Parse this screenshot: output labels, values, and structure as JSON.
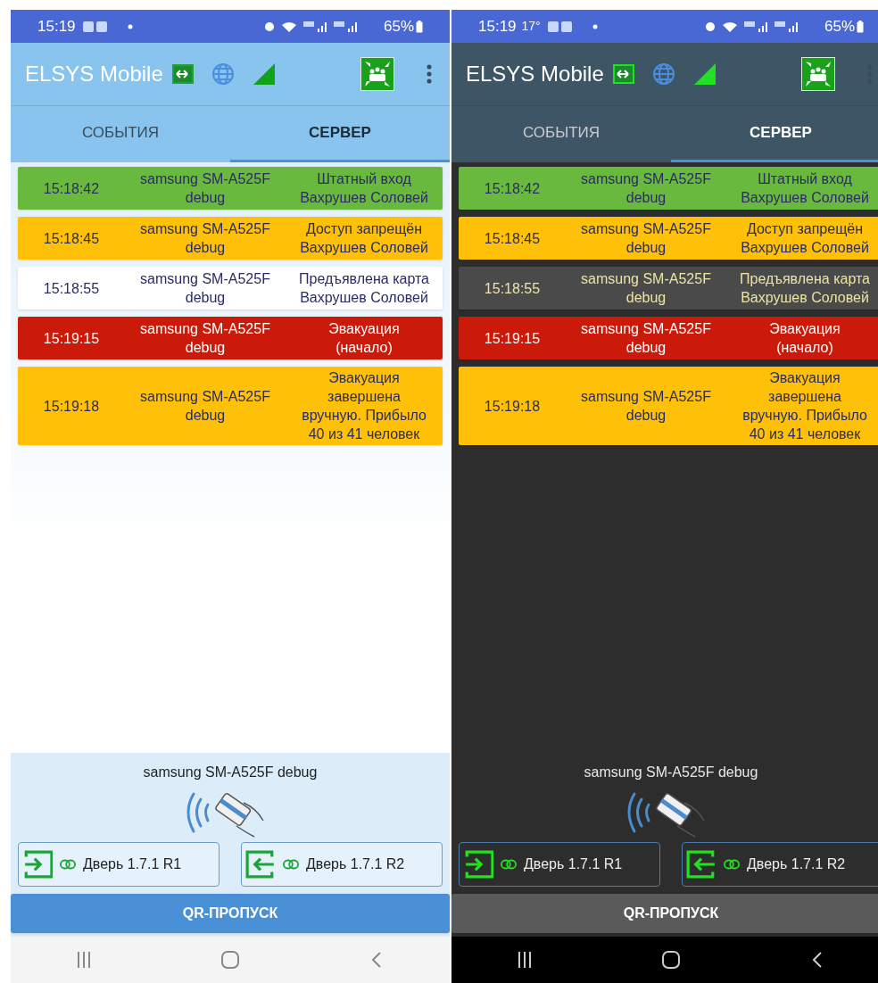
{
  "screens": [
    {
      "dark_mode": false,
      "status_bar": {
        "time": "15:19",
        "battery": "65%"
      },
      "app_bar": {
        "title": "ELSYS Mobile"
      },
      "tabs": [
        {
          "label": "СОБЫТИЯ",
          "selected": false
        },
        {
          "label": "СЕРВЕР",
          "selected": true
        }
      ],
      "events": [
        {
          "kind": "pass",
          "time": "15:18:42",
          "device": "samsung SM-A525F\ndebug",
          "event": "Штатный вход\nВахрушев Соловей",
          "color": "#6ab93f"
        },
        {
          "kind": "denied",
          "time": "15:18:45",
          "device": "samsung SM-A525F\ndebug",
          "event": "Доступ запрещён\nВахрушев Соловей",
          "color": "#ffc107"
        },
        {
          "kind": "card",
          "time": "15:18:55",
          "device": "samsung SM-A525F\ndebug",
          "event": "Предъявлена карта\nВахрушев Соловей",
          "color": "#ffffff"
        },
        {
          "kind": "alarm",
          "time": "15:19:15",
          "device": "samsung SM-A525F\ndebug",
          "event": "Эвакуация\n(начало)",
          "color": "#cc1a0a"
        },
        {
          "kind": "evacuation_end",
          "time": "15:19:18",
          "device": "samsung SM-A525F\ndebug",
          "event": "Эвакуация\nзавершена\nвручную. Прибыло\n40 из 41 человек",
          "color": "#ffc107"
        }
      ],
      "reader": {
        "device": "samsung SM-A525F debug"
      },
      "doors": [
        {
          "kind": "entry",
          "label": "Дверь 1.7.1 R1"
        },
        {
          "kind": "exit",
          "label": "Дверь 1.7.1 R2"
        }
      ],
      "qr_button": "QR-ПРОПУСК"
    },
    {
      "dark_mode": true,
      "status_bar": {
        "time": "15:19",
        "temperature": "17°",
        "battery": "65%"
      },
      "app_bar": {
        "title": "ELSYS Mobile"
      },
      "tabs": [
        {
          "label": "СОБЫТИЯ",
          "selected": false
        },
        {
          "label": "СЕРВЕР",
          "selected": true
        }
      ],
      "events": [
        {
          "kind": "pass",
          "time": "15:18:42",
          "device": "samsung SM-A525F\ndebug",
          "event": "Штатный вход\nВахрушев Соловей",
          "color": "#6ab93f"
        },
        {
          "kind": "denied",
          "time": "15:18:45",
          "device": "samsung SM-A525F\ndebug",
          "event": "Доступ запрещён\nВахрушев Соловей",
          "color": "#ffc107"
        },
        {
          "kind": "card",
          "time": "15:18:55",
          "device": "samsung SM-A525F\ndebug",
          "event": "Предъявлена карта\nВахрушев Соловей",
          "color": "#4a4a4a"
        },
        {
          "kind": "alarm",
          "time": "15:19:15",
          "device": "samsung SM-A525F\ndebug",
          "event": "Эвакуация\n(начало)",
          "color": "#cc1a0a"
        },
        {
          "kind": "evacuation_end",
          "time": "15:19:18",
          "device": "samsung SM-A525F\ndebug",
          "event": "Эвакуация\nзавершена\nвручную. Прибыло\n40 из 41 человек",
          "color": "#ffc107"
        }
      ],
      "reader": {
        "device": "samsung SM-A525F debug"
      },
      "doors": [
        {
          "kind": "entry",
          "label": "Дверь 1.7.1 R1"
        },
        {
          "kind": "exit",
          "label": "Дверь 1.7.1 R2"
        }
      ],
      "qr_button": "QR-ПРОПУСК"
    }
  ]
}
